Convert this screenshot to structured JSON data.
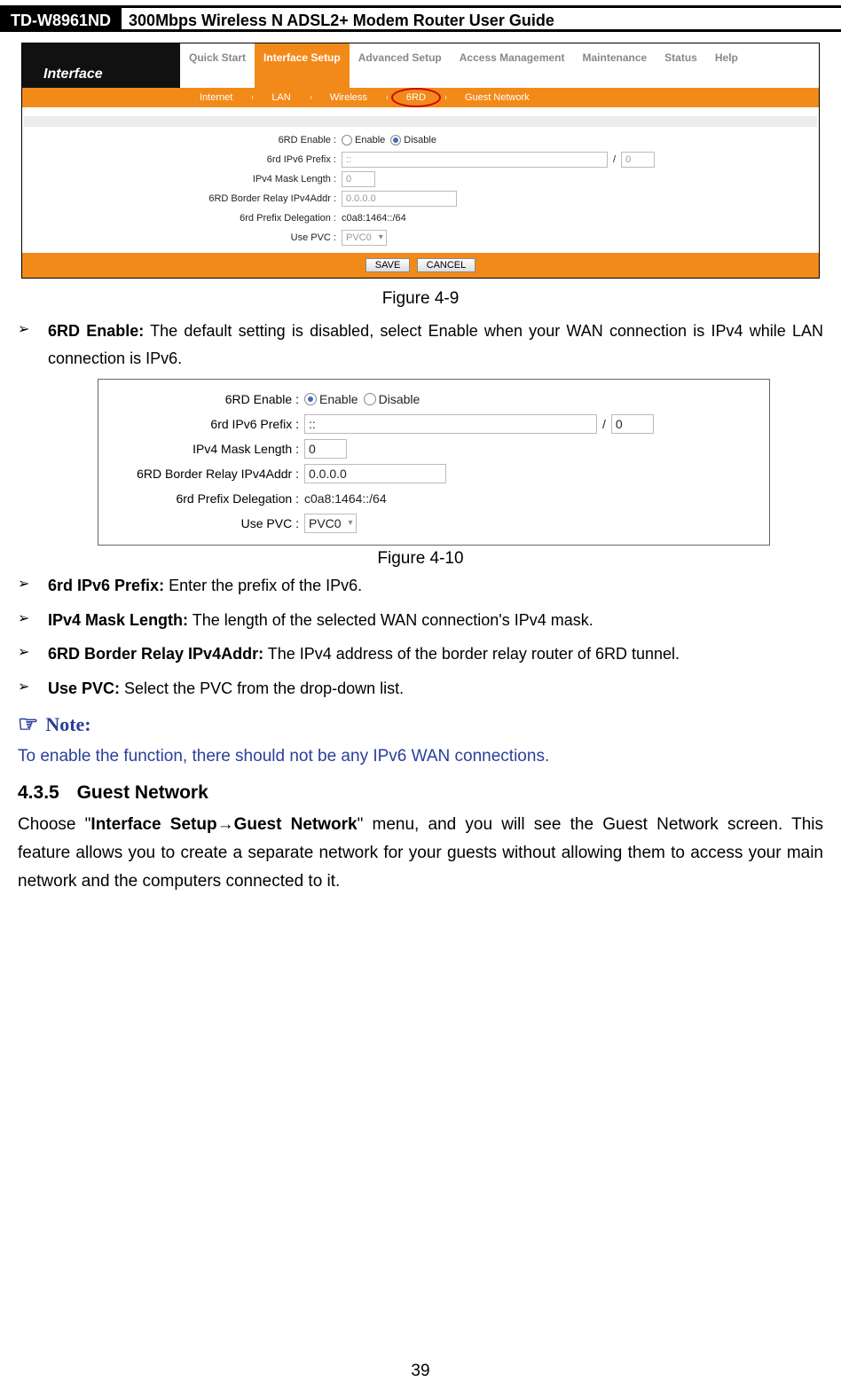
{
  "header": {
    "model": "TD-W8961ND",
    "title": "300Mbps Wireless N ADSL2+ Modem Router User Guide"
  },
  "ss1": {
    "interface_label": "Interface",
    "tabs": [
      "Quick Start",
      "Interface Setup",
      "Advanced Setup",
      "Access Management",
      "Maintenance",
      "Status",
      "Help"
    ],
    "subtabs": [
      "Internet",
      "LAN",
      "Wireless",
      "6RD",
      "Guest Network"
    ],
    "fields": {
      "enable_label": "6RD Enable :",
      "enable_opt1": "Enable",
      "enable_opt2": "Disable",
      "prefix_label": "6rd IPv6 Prefix :",
      "prefix_value": "::",
      "prefix_slash": "/",
      "prefix_len": "0",
      "mask_label": "IPv4 Mask Length :",
      "mask_value": "0",
      "relay_label": "6RD Border Relay IPv4Addr :",
      "relay_value": "0.0.0.0",
      "deleg_label": "6rd Prefix Delegation :",
      "deleg_value": "c0a8:1464::/64",
      "pvc_label": "Use PVC :",
      "pvc_value": "PVC0"
    },
    "save_label": "SAVE",
    "cancel_label": "CANCEL"
  },
  "caption1": "Figure 4-9",
  "bullets1": [
    {
      "term": "6RD Enable:",
      "desc": " The default setting is disabled, select Enable when your WAN connection is IPv4 while LAN connection is IPv6."
    }
  ],
  "ss2": {
    "fields": {
      "enable_label": "6RD Enable :",
      "enable_opt1": "Enable",
      "enable_opt2": "Disable",
      "prefix_label": "6rd IPv6 Prefix :",
      "prefix_value": "::",
      "prefix_slash": "/",
      "prefix_len": "0",
      "mask_label": "IPv4 Mask Length :",
      "mask_value": "0",
      "relay_label": "6RD Border Relay IPv4Addr :",
      "relay_value": "0.0.0.0",
      "deleg_label": "6rd Prefix Delegation :",
      "deleg_value": "c0a8:1464::/64",
      "pvc_label": "Use PVC :",
      "pvc_value": "PVC0"
    }
  },
  "caption2": "Figure 4-10",
  "bullets2": [
    {
      "term": "6rd IPv6 Prefix:",
      "desc": " Enter the prefix of the IPv6."
    },
    {
      "term": "IPv4 Mask Length:",
      "desc": " The length of the selected WAN connection's IPv4 mask."
    },
    {
      "term": "6RD Border Relay IPv4Addr:",
      "desc": " The IPv4 address of the border relay router of 6RD tunnel."
    },
    {
      "term": "Use PVC:",
      "desc": " Select the PVC from the drop-down list."
    }
  ],
  "note": {
    "icon": "☞",
    "title": "Note:",
    "body": "To enable the function, there should not be any IPv6 WAN connections."
  },
  "section": {
    "num": "4.3.5",
    "title": "Guest Network",
    "para_pre": "Choose \"",
    "para_bold": "Interface Setup→Guest Network",
    "para_post": "\" menu, and you will see the Guest Network screen. This feature allows you to create a separate network for your guests without allowing them to access your main network and the computers connected to it."
  },
  "page_number": "39"
}
